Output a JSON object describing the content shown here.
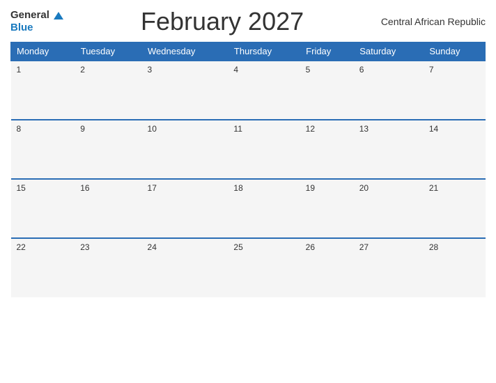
{
  "header": {
    "logo_general": "General",
    "logo_blue": "Blue",
    "title": "February 2027",
    "country": "Central African Republic"
  },
  "calendar": {
    "days_of_week": [
      "Monday",
      "Tuesday",
      "Wednesday",
      "Thursday",
      "Friday",
      "Saturday",
      "Sunday"
    ],
    "weeks": [
      [
        {
          "day": 1
        },
        {
          "day": 2
        },
        {
          "day": 3
        },
        {
          "day": 4
        },
        {
          "day": 5
        },
        {
          "day": 6
        },
        {
          "day": 7
        }
      ],
      [
        {
          "day": 8
        },
        {
          "day": 9
        },
        {
          "day": 10
        },
        {
          "day": 11
        },
        {
          "day": 12
        },
        {
          "day": 13
        },
        {
          "day": 14
        }
      ],
      [
        {
          "day": 15
        },
        {
          "day": 16
        },
        {
          "day": 17
        },
        {
          "day": 18
        },
        {
          "day": 19
        },
        {
          "day": 20
        },
        {
          "day": 21
        }
      ],
      [
        {
          "day": 22
        },
        {
          "day": 23
        },
        {
          "day": 24
        },
        {
          "day": 25
        },
        {
          "day": 26
        },
        {
          "day": 27
        },
        {
          "day": 28
        }
      ]
    ]
  }
}
